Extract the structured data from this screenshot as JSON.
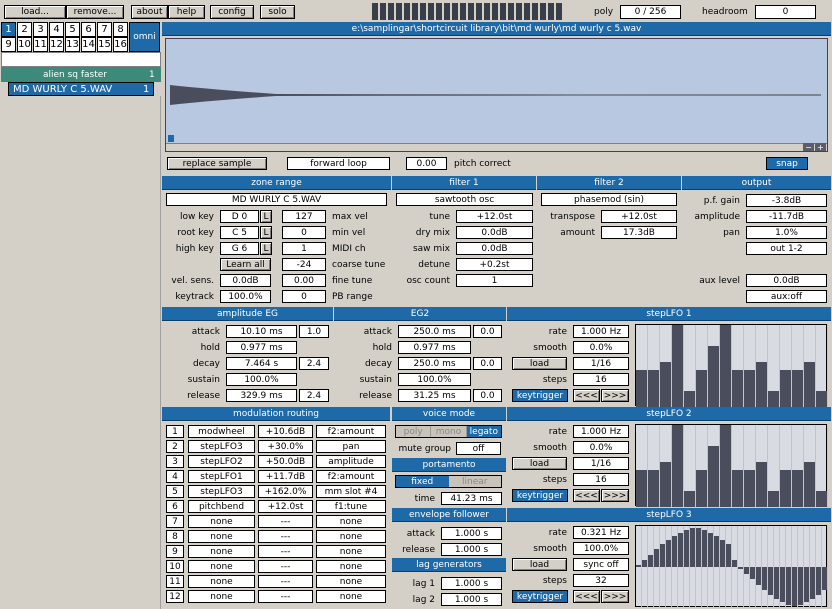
{
  "toolbar": {
    "load": "load...",
    "remove": "remove...",
    "about": "about",
    "help": "help",
    "config": "config",
    "solo": "solo",
    "poly_label": "poly",
    "poly_value": "0 / 256",
    "headroom_label": "headroom",
    "headroom_value": "0"
  },
  "channels": {
    "row1": [
      "1",
      "2",
      "3",
      "4",
      "5",
      "6",
      "7",
      "8"
    ],
    "row2": [
      "9",
      "10",
      "11",
      "12",
      "13",
      "14",
      "15",
      "16"
    ],
    "omni": "omni"
  },
  "zones": {
    "group_name": "alien sq faster",
    "group_num": "1",
    "sample_name": "MD WURLY C 5.WAV",
    "sample_num": "1"
  },
  "waveform": {
    "path": "e:\\samplingar\\shortcircuit library\\bit\\md wurly\\md wurly c 5.wav",
    "replace_sample": "replace sample",
    "loop_mode": "forward loop",
    "pitch_value": "0.00",
    "pitch_label": "pitch correct",
    "snap": "snap"
  },
  "zone_range": {
    "title": "zone range",
    "sample": "MD WURLY C 5.WAV",
    "low_key_label": "low key",
    "low_key": "D 0",
    "root_key_label": "root key",
    "root_key": "C 5",
    "high_key_label": "high key",
    "high_key": "G 6",
    "learn_all": "Learn all",
    "vel_sens_label": "vel. sens.",
    "vel_sens": "0.0dB",
    "keytrack_label": "keytrack",
    "keytrack": "100.0%",
    "l": "L",
    "max_vel": "127",
    "max_vel_label": "max vel",
    "min_vel": "0",
    "min_vel_label": "min vel",
    "midi_ch": "1",
    "midi_ch_label": "MIDI ch",
    "coarse": "-24",
    "coarse_label": "coarse tune",
    "fine": "0.00",
    "fine_label": "fine tune",
    "pb": "0",
    "pb_label": "PB range"
  },
  "filter1": {
    "title": "filter 1",
    "type": "sawtooth osc",
    "tune_label": "tune",
    "tune": "+12.0st",
    "dry_label": "dry mix",
    "dry": "0.0dB",
    "saw_label": "saw mix",
    "saw": "0.0dB",
    "detune_label": "detune",
    "detune": "+0.2st",
    "osc_label": "osc count",
    "osc": "1"
  },
  "filter2": {
    "title": "filter 2",
    "type": "phasemod (sin)",
    "transpose_label": "transpose",
    "transpose": "+12.0st",
    "amount_label": "amount",
    "amount": "17.3dB"
  },
  "output": {
    "title": "output",
    "pf_label": "p.f. gain",
    "pf": "-3.8dB",
    "amp_label": "amplitude",
    "amp": "-11.7dB",
    "pan_label": "pan",
    "pan": "1.0%",
    "out": "out 1-2",
    "aux_label": "aux level",
    "aux": "0.0dB",
    "aux_mode": "aux:off"
  },
  "amp_eg": {
    "title": "amplitude EG",
    "attack_label": "attack",
    "attack": "10.10 ms",
    "attack_shape": "1.0",
    "hold_label": "hold",
    "hold": "0.977 ms",
    "decay_label": "decay",
    "decay": "7.464 s",
    "decay_shape": "2.4",
    "sustain_label": "sustain",
    "sustain": "100.0%",
    "release_label": "release",
    "release": "329.9 ms",
    "release_shape": "2.4"
  },
  "eg2": {
    "title": "EG2",
    "attack_label": "attack",
    "attack": "250.0 ms",
    "attack_shape": "0.0",
    "hold_label": "hold",
    "hold": "0.977 ms",
    "decay_label": "decay",
    "decay": "250.0 ms",
    "decay_shape": "0.0",
    "sustain_label": "sustain",
    "sustain": "100.0%",
    "release_label": "release",
    "release": "31.25 ms",
    "release_shape": "0.0"
  },
  "lfo_common": {
    "rate_label": "rate",
    "smooth_label": "smooth",
    "steps_label": "steps",
    "keytrigger": "keytrigger",
    "prev": "<<<",
    "next": ">>>"
  },
  "lfo1": {
    "title": "stepLFO 1",
    "rate": "1.000 Hz",
    "smooth": "0.0%",
    "mode": "load",
    "sync": "1/16",
    "steps": "16",
    "values": [
      0.45,
      0.45,
      0.55,
      1.0,
      0.2,
      0.45,
      0.75,
      1.0,
      0.45,
      0.45,
      0.55,
      0.2,
      0.45,
      0.45,
      0.55,
      0.2
    ]
  },
  "lfo2": {
    "title": "stepLFO 2",
    "rate": "1.000 Hz",
    "smooth": "0.0%",
    "mode": "load",
    "sync": "1/16",
    "steps": "16",
    "values": [
      0.45,
      0.45,
      0.55,
      1.0,
      0.2,
      0.45,
      0.75,
      1.0,
      0.45,
      0.45,
      0.55,
      0.2,
      0.45,
      0.45,
      0.55,
      0.2
    ]
  },
  "lfo3": {
    "title": "stepLFO 3",
    "rate": "0.321 Hz",
    "smooth": "100.0%",
    "mode": "load",
    "sync": "sync off",
    "steps": "32",
    "values": [
      0.52,
      0.58,
      0.65,
      0.72,
      0.78,
      0.83,
      0.88,
      0.92,
      0.95,
      0.97,
      0.97,
      0.95,
      0.92,
      0.88,
      0.83,
      0.78,
      0.58,
      0.48,
      0.42,
      0.35,
      0.28,
      0.22,
      0.16,
      0.11,
      0.07,
      0.04,
      0.03,
      0.04,
      0.07,
      0.11,
      0.16,
      0.22
    ]
  },
  "mod_routing": {
    "title": "modulation routing",
    "rows": [
      {
        "n": "1",
        "src": "modwheel",
        "amt": "+10.6dB",
        "dst": "f2:amount"
      },
      {
        "n": "2",
        "src": "stepLFO3",
        "amt": "+30.0%",
        "dst": "pan"
      },
      {
        "n": "3",
        "src": "stepLFO2",
        "amt": "+50.0dB",
        "dst": "amplitude"
      },
      {
        "n": "4",
        "src": "stepLFO1",
        "amt": "+11.7dB",
        "dst": "f2:amount"
      },
      {
        "n": "5",
        "src": "stepLFO3",
        "amt": "+162.0%",
        "dst": "mm slot #4"
      },
      {
        "n": "6",
        "src": "pitchbend",
        "amt": "+12.0st",
        "dst": "f1:tune"
      },
      {
        "n": "7",
        "src": "none",
        "amt": "---",
        "dst": "none"
      },
      {
        "n": "8",
        "src": "none",
        "amt": "---",
        "dst": "none"
      },
      {
        "n": "9",
        "src": "none",
        "amt": "---",
        "dst": "none"
      },
      {
        "n": "10",
        "src": "none",
        "amt": "---",
        "dst": "none"
      },
      {
        "n": "11",
        "src": "none",
        "amt": "---",
        "dst": "none"
      },
      {
        "n": "12",
        "src": "none",
        "amt": "---",
        "dst": "none"
      }
    ]
  },
  "voice_mode": {
    "title": "voice mode",
    "poly": "poly",
    "mono": "mono",
    "legato": "legato",
    "mute_label": "mute group",
    "mute": "off"
  },
  "portamento": {
    "title": "portamento",
    "fixed": "fixed",
    "linear": "linear",
    "time_label": "time",
    "time": "41.23 ms"
  },
  "env_follower": {
    "title": "envelope follower",
    "attack_label": "attack",
    "attack": "1.000 s",
    "release_label": "release",
    "release": "1.000 s"
  },
  "lag": {
    "title": "lag generators",
    "lag1_label": "lag 1",
    "lag1": "1.000 s",
    "lag2_label": "lag 2",
    "lag2": "1.000 s"
  },
  "colors": {
    "accent": "#1e6aa8",
    "panel": "#d4d0c8",
    "step_dark": "#4a4e5c",
    "step_light": "#d8dbe2"
  }
}
